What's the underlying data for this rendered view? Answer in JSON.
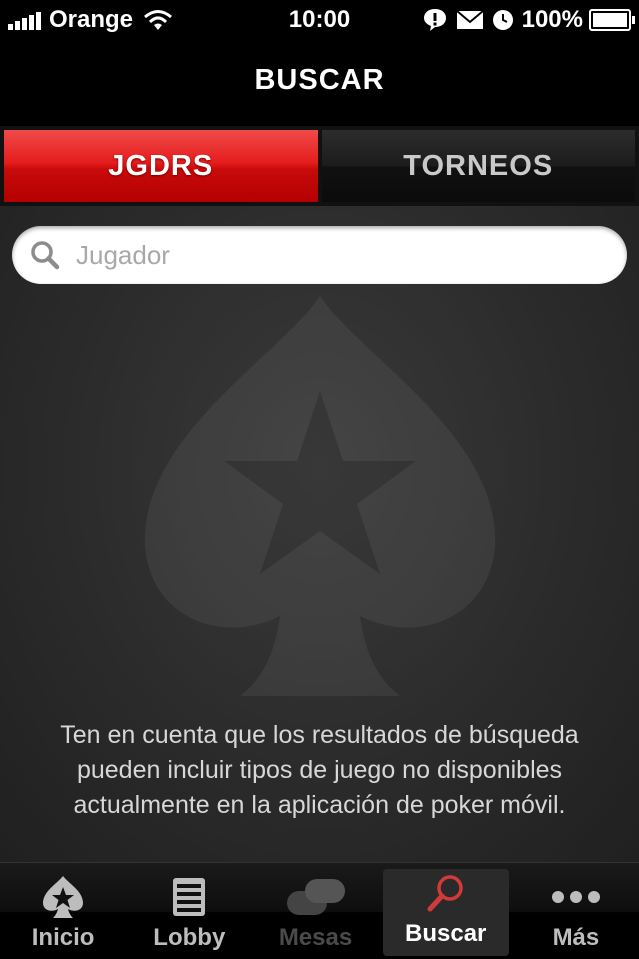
{
  "status_bar": {
    "carrier": "Orange",
    "time": "10:00",
    "battery": "100%",
    "icons": [
      "signal-icon",
      "wifi-icon",
      "alert-icon",
      "mail-icon",
      "clock-icon",
      "battery-icon"
    ]
  },
  "nav": {
    "title": "BUSCAR"
  },
  "tabs": [
    {
      "label": "JGDRS",
      "active": true
    },
    {
      "label": "TORNEOS",
      "active": false
    }
  ],
  "search": {
    "placeholder": "Jugador",
    "value": ""
  },
  "notice": "Ten en cuenta que los resultados de búsqueda pueden incluir tipos de juego no disponibles actualmente en la aplicación de poker móvil.",
  "tabbar": {
    "items": [
      {
        "label": "Inicio",
        "icon": "spade-star-icon",
        "state": "normal"
      },
      {
        "label": "Lobby",
        "icon": "list-icon",
        "state": "normal"
      },
      {
        "label": "Mesas",
        "icon": "tables-icon",
        "state": "disabled"
      },
      {
        "label": "Buscar",
        "icon": "search-icon",
        "state": "selected"
      },
      {
        "label": "Más",
        "icon": "more-icon",
        "state": "normal"
      }
    ]
  },
  "colors": {
    "accent_red": "#e51d1d",
    "search_icon_red": "#d23a3a"
  }
}
